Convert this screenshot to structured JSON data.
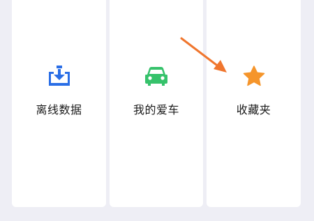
{
  "cards": [
    {
      "label": "离线数据",
      "icon": "offline-data-download-icon",
      "color": "#2a6ee6"
    },
    {
      "label": "我的爱车",
      "icon": "car-icon",
      "color": "#36c26b"
    },
    {
      "label": "收藏夹",
      "icon": "star-icon",
      "color": "#f5952b"
    }
  ],
  "annotation": {
    "arrow_color": "#f0762e"
  }
}
